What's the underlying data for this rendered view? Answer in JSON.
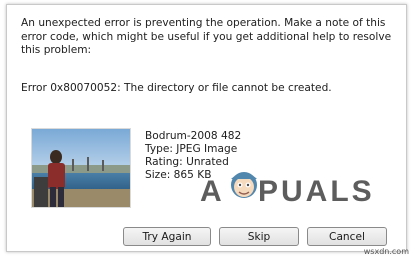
{
  "dialog": {
    "message": "An unexpected error is preventing the operation. Make a note of this error code, which might be useful if you get additional help to resolve this problem:",
    "error": "Error 0x80070052: The directory or file cannot be created."
  },
  "file": {
    "name": "Bodrum-2008 482",
    "type": "Type: JPEG Image",
    "rating": "Rating: Unrated",
    "size": "Size: 865 KB"
  },
  "buttons": {
    "try_again": "Try Again",
    "skip": "Skip",
    "cancel": "Cancel"
  },
  "watermark": {
    "logo_text": "APPUALS",
    "icon": "appuals-mascot-icon"
  },
  "site_label": "wsxdn.com",
  "colors": {
    "logo": "#3a3a3a",
    "accent": "#1b6fb3"
  }
}
